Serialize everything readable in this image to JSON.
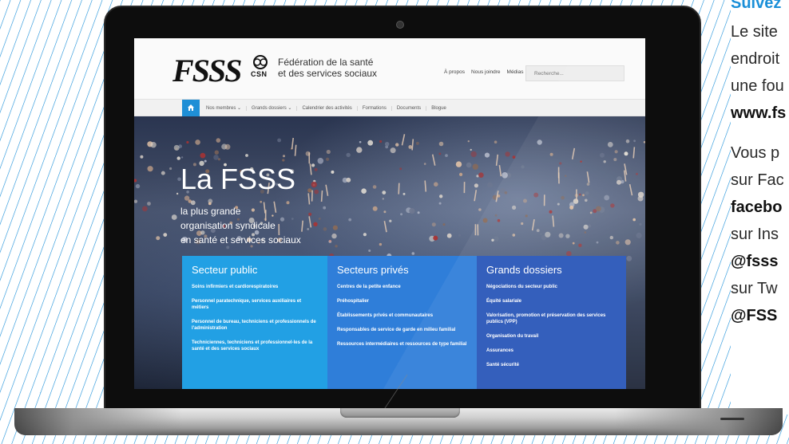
{
  "side_text": {
    "lines": [
      {
        "text": "Suivez",
        "style": "blue"
      },
      {
        "text": "Le site",
        "style": "normal"
      },
      {
        "text": "endroit",
        "style": "normal"
      },
      {
        "text": "une fou",
        "style": "normal"
      },
      {
        "text": "www.fs",
        "style": "bold"
      },
      {
        "text": "Vous p",
        "style": "normal"
      },
      {
        "text": "sur Fac",
        "style": "normal"
      },
      {
        "text": "facebo",
        "style": "bold"
      },
      {
        "text": "sur Ins",
        "style": "normal"
      },
      {
        "text": "@fsss",
        "style": "bold"
      },
      {
        "text": "sur Tw",
        "style": "normal"
      },
      {
        "text": "@FSS",
        "style": "bold"
      }
    ]
  },
  "site": {
    "logo": {
      "mark": "FSSS",
      "org": "CSN",
      "name_line1": "Fédération de la santé",
      "name_line2": "et des services sociaux"
    },
    "top_links": [
      "À propos",
      "Nous joindre",
      "Médias"
    ],
    "search_placeholder": "Recherche...",
    "nav": {
      "items": [
        "Nos membres ⌄",
        "Grands dossiers ⌄",
        "Calendrier des activités",
        "Formations",
        "Documents",
        "Blogue"
      ]
    },
    "hero": {
      "title": "La FSSS",
      "subtitle_lines": [
        "la plus grande",
        "organisation syndicale",
        "en santé et services sociaux"
      ]
    },
    "columns": [
      {
        "title": "Secteur public",
        "links": [
          "Soins infirmiers et cardiorespiratoires",
          "Personnel paratechnique, services auxiliaires et métiers",
          "Personnel de bureau, techniciens et professionnels de l'administration",
          "Techniciennes, techniciens et professionnel-les de la santé et des services sociaux"
        ]
      },
      {
        "title": "Secteurs privés",
        "links": [
          "Centres de la petite enfance",
          "Préhospitalier",
          "Établissements privés et communautaires",
          "Responsables de service de garde en milieu familial",
          "Ressources intermédiaires et ressources de type familial"
        ]
      },
      {
        "title": "Grands dossiers",
        "links": [
          "Négociations du secteur public",
          "Équité salariale",
          "Valorisation, promotion et préservation des services publics (VPP)",
          "Organisation du travail",
          "Assurances",
          "Santé sécurité"
        ]
      }
    ]
  },
  "colors": {
    "accent_light": "#22a0e4",
    "accent_mid": "#2f7ed9",
    "accent_dark": "#2855b8",
    "side_title": "#1a8fd8"
  },
  "icons": {
    "home": "home-icon",
    "emblem": "csn-emblem-icon",
    "camera": "camera-icon"
  }
}
